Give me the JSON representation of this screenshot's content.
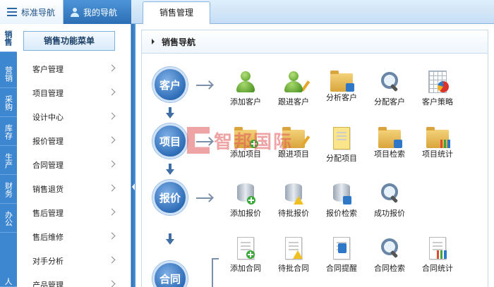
{
  "top_tabs": [
    {
      "label": "标准导航",
      "icon": "list-icon"
    },
    {
      "label": "我的导航",
      "icon": "person-icon"
    }
  ],
  "main_tab": {
    "label": "销售管理"
  },
  "vertical_tabs": [
    "销售",
    "营销",
    "采购",
    "库存",
    "生产",
    "财务",
    "办公",
    "人"
  ],
  "menu": {
    "header": "销售功能菜单",
    "items": [
      "客户管理",
      "项目管理",
      "设计中心",
      "报价管理",
      "合同管理",
      "销售退货",
      "售后管理",
      "售后维修",
      "对手分析",
      "产品管理"
    ]
  },
  "section_title": "销售导航",
  "flow": [
    {
      "stage": "客户",
      "tools": [
        {
          "label": "添加客户",
          "icon": "add-customer-icon"
        },
        {
          "label": "跟进客户",
          "icon": "follow-customer-icon"
        },
        {
          "label": "分析客户",
          "icon": "analyze-customer-icon"
        },
        {
          "label": "分配客户",
          "icon": "assign-customer-icon"
        },
        {
          "label": "客户策略",
          "icon": "customer-strategy-icon"
        }
      ]
    },
    {
      "stage": "项目",
      "tools": [
        {
          "label": "添加项目",
          "icon": "add-project-icon"
        },
        {
          "label": "跟进项目",
          "icon": "follow-project-icon"
        },
        {
          "label": "分配项目",
          "icon": "assign-project-icon"
        },
        {
          "label": "项目检索",
          "icon": "search-project-icon"
        },
        {
          "label": "项目统计",
          "icon": "project-stats-icon"
        }
      ]
    },
    {
      "stage": "报价",
      "tools": [
        {
          "label": "添加报价",
          "icon": "add-quote-icon"
        },
        {
          "label": "待批报价",
          "icon": "pending-quote-icon"
        },
        {
          "label": "报价检索",
          "icon": "search-quote-icon"
        },
        {
          "label": "成功报价",
          "icon": "successful-quote-icon"
        }
      ]
    },
    {
      "stage": "合同",
      "tools": [
        {
          "label": "添加合同",
          "icon": "add-contract-icon"
        },
        {
          "label": "待批合同",
          "icon": "pending-contract-icon"
        },
        {
          "label": "合同提醒",
          "icon": "contract-reminder-icon"
        },
        {
          "label": "合同检索",
          "icon": "search-contract-icon"
        },
        {
          "label": "合同统计",
          "icon": "contract-stats-icon"
        }
      ]
    }
  ],
  "watermark": {
    "text": "智邦国际"
  },
  "colors": {
    "accent": "#3d87d0",
    "stage_circle": "#2e6db8",
    "watermark": "#e15a5a"
  }
}
